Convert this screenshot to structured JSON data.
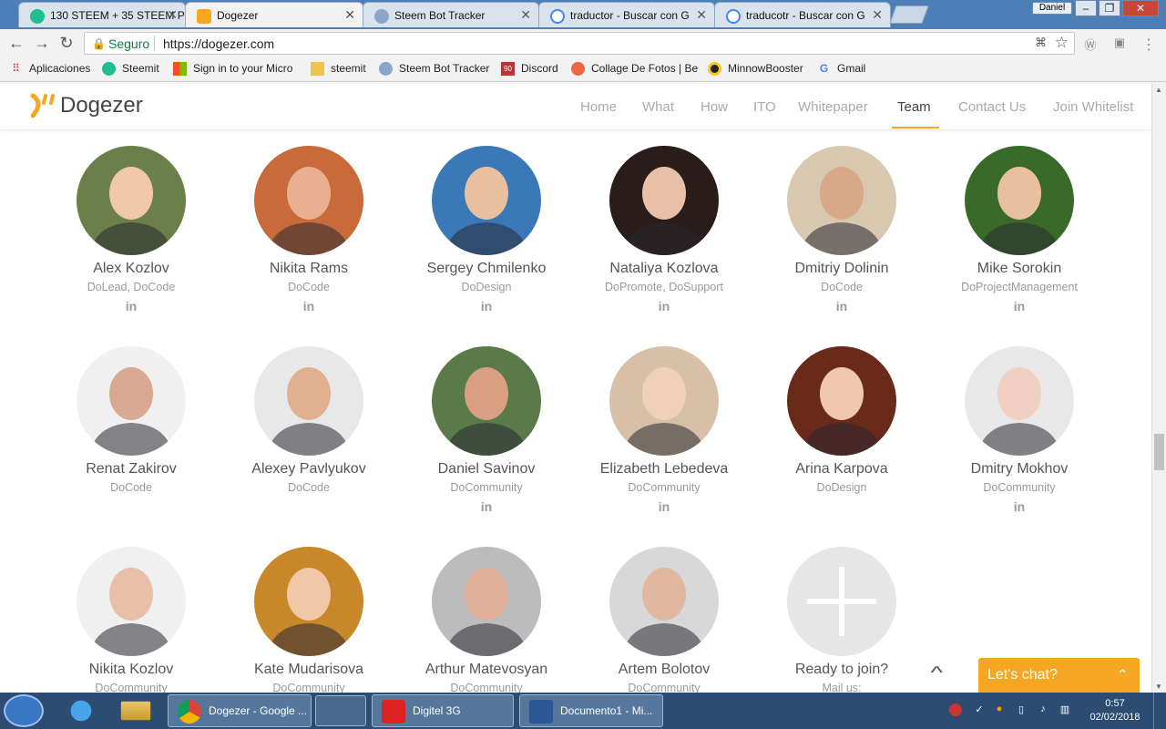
{
  "browser": {
    "tabs": [
      {
        "title": "130 STEEM + 35 STEEM P",
        "icon": "steemit-icon",
        "active": false
      },
      {
        "title": "Dogezer",
        "icon": "dogezer-icon",
        "active": true
      },
      {
        "title": "Steem Bot Tracker",
        "icon": "bot-icon",
        "active": false
      },
      {
        "title": "traductor - Buscar con G",
        "icon": "google-icon",
        "active": false
      },
      {
        "title": "traducotr - Buscar con G",
        "icon": "google-icon",
        "active": false
      }
    ],
    "profile_name": "Daniel",
    "secure_label": "Seguro",
    "url": "https://dogezer.com",
    "bookmarks": [
      {
        "label": "Aplicaciones",
        "icon": "apps-grid-icon"
      },
      {
        "label": "Steemit",
        "icon": "steemit-icon"
      },
      {
        "label": "Sign in to your Micro",
        "icon": "microsoft-icon"
      },
      {
        "label": "steemit",
        "icon": "folder-icon"
      },
      {
        "label": "Steem Bot Tracker",
        "icon": "bot-icon"
      },
      {
        "label": "Discord",
        "icon": "discord-icon"
      },
      {
        "label": "Collage De Fotos | Be",
        "icon": "collage-icon"
      },
      {
        "label": "MinnowBooster",
        "icon": "minnow-icon"
      },
      {
        "label": "Gmail",
        "icon": "google-icon"
      }
    ]
  },
  "site": {
    "logo_text": "Dogezer",
    "nav": [
      "Home",
      "What",
      "How",
      "ITO",
      "Whitepaper",
      "Team",
      "Contact Us",
      "Join Whitelist"
    ],
    "active_nav": "Team",
    "accent_color": "#f5a623"
  },
  "team": [
    {
      "name": "Alex Kozlov",
      "role": "DoLead, DoCode",
      "linkedin": true
    },
    {
      "name": "Nikita Rams",
      "role": "DoCode",
      "linkedin": true
    },
    {
      "name": "Sergey Chmilenko",
      "role": "DoDesign",
      "linkedin": true
    },
    {
      "name": "Nataliya Kozlova",
      "role": "DoPromote, DoSupport",
      "linkedin": true
    },
    {
      "name": "Dmitriy Dolinin",
      "role": "DoCode",
      "linkedin": true
    },
    {
      "name": "Mike Sorokin",
      "role": "DoProjectManagement",
      "linkedin": true
    },
    {
      "name": "Renat Zakirov",
      "role": "DoCode",
      "linkedin": false
    },
    {
      "name": "Alexey Pavlyukov",
      "role": "DoCode",
      "linkedin": false
    },
    {
      "name": "Daniel Savinov",
      "role": "DoCommunity",
      "linkedin": true
    },
    {
      "name": "Elizabeth Lebedeva",
      "role": "DoCommunity",
      "linkedin": true
    },
    {
      "name": "Arina Karpova",
      "role": "DoDesign",
      "linkedin": false
    },
    {
      "name": "Dmitry Mokhov",
      "role": "DoCommunity",
      "linkedin": true
    },
    {
      "name": "Nikita Kozlov",
      "role": "DoCommunity",
      "linkedin": false
    },
    {
      "name": "Kate Mudarisova",
      "role": "DoCommunity",
      "linkedin": false
    },
    {
      "name": "Arthur Matevosyan",
      "role": "DoCommunity",
      "linkedin": false
    },
    {
      "name": "Artem Bolotov",
      "role": "DoCommunity",
      "linkedin": false
    },
    {
      "name": "Ready to join?",
      "role": "Mail us:",
      "linkedin": false,
      "placeholder": true
    }
  ],
  "linkedin_label": "in",
  "chat": {
    "label": "Let's chat?"
  },
  "taskbar": {
    "tasks": [
      {
        "label": "Dogezer - Google ...",
        "icon": "chrome-icon"
      },
      {
        "label": "Digitel 3G",
        "icon": "digitel-icon"
      },
      {
        "label": "Documento1 - Mi...",
        "icon": "word-icon"
      }
    ],
    "clock_time": "0:57",
    "clock_date": "02/02/2018"
  }
}
